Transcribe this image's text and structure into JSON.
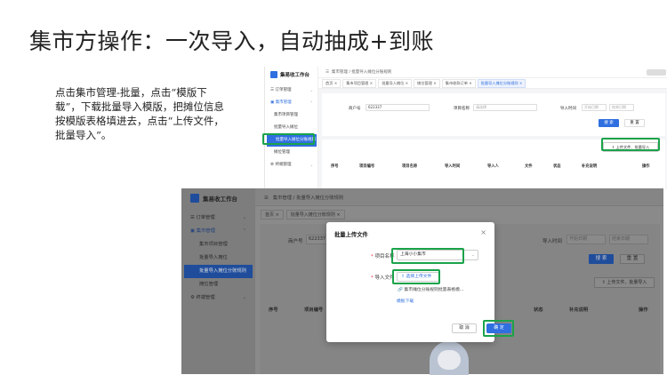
{
  "slide": {
    "title": "集市方操作：一次导入，自动抽成+到账",
    "instructions": "点击集市管理-批量，点击“模版下载”，下载批量导入模版，把摊位信息按模版表格填进去，点击“上传文件，批量导入”。"
  },
  "app": {
    "name": "集易收工作台",
    "accent_color": "#2f6fe0",
    "highlight_color": "#1aa34a"
  },
  "shot1": {
    "menu": {
      "order": "订单管理",
      "market": "集市管理",
      "items": [
        "集市项目管理",
        "批量导入摊位",
        "批量导入摊位分账规则",
        "摊位管理"
      ],
      "terminal": "终端管理"
    },
    "breadcrumb": "集市管理 / 批量导入摊位分账规则",
    "tabs": [
      "首页 ×",
      "集市项目管理 ×",
      "批量导入摊位 ×",
      "摊位管理 ×",
      "集市收款订单 ×",
      "批量导入摊位分账规则 ×"
    ],
    "merchant_label": "商户号",
    "merchant_value": "622337",
    "project_label": "项目名称",
    "project_placeholder": "请选择",
    "import_time_label": "导入时间",
    "start_date": "开始日期",
    "end_date": "结束日期",
    "search_btn": "搜 索",
    "reset_btn": "重 置",
    "upload_btn": "上传文件、批量导入",
    "columns": [
      "序号",
      "项目编号",
      "项目名称",
      "导入时间",
      "导入人",
      "文件",
      "状态",
      "补充说明",
      "操作"
    ]
  },
  "shot2": {
    "menu": {
      "order": "订单管理",
      "market": "集市管理",
      "items": [
        "集市项目管理",
        "批量导入摊位",
        "批量导入摊位分账规则",
        "摊位管理"
      ],
      "terminal": "终端管理"
    },
    "breadcrumb": "集市管理 / 批量导入摊位分账规则",
    "tabs": [
      "首页 ×",
      "批量导入摊位分账规则 ×"
    ],
    "merchant_label": "商户号",
    "merchant_value": "622337",
    "import_time_label": "导入时间",
    "start_date": "开始日期",
    "end_date": "结束日期",
    "search_btn": "搜 索",
    "reset_btn": "重 置",
    "upload_btn": "上传文件、批量导入",
    "columns": [
      "序号",
      "项目编号",
      "状态",
      "补充说明",
      "操作"
    ]
  },
  "modal": {
    "title": "批量上传文件",
    "project_label": "项目名称",
    "project_value": "上海小小集市",
    "file_label": "导入文件",
    "upload_btn": "选择上传文件",
    "file_name": "集市摊位分账规则批量表格模...",
    "template_link": "模板下载",
    "cancel_btn": "取 消",
    "ok_btn": "确 定"
  }
}
